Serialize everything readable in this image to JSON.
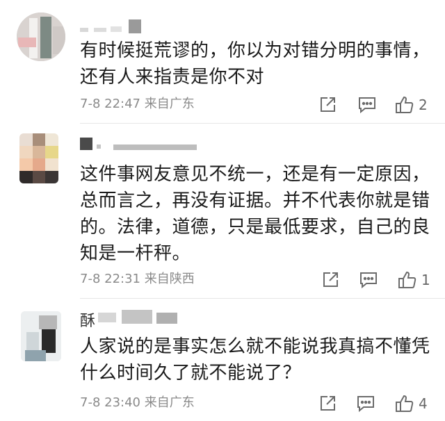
{
  "comments": [
    {
      "text": "有时候挺荒谬的，你以为对错分明的事情，还有人来指责是你不对",
      "time": "7-8 22:47",
      "location": "来自广东",
      "likes": "2"
    },
    {
      "text": "这件事网友意见不统一，还是有一定原因，总而言之，再没有证据。并不代表你就是错的。法律，道德，只是最低要求，自己的良知是一杆秤。",
      "time": "7-8 22:31",
      "location": "来自陕西",
      "likes": "1"
    },
    {
      "username_visible": "酥",
      "text": "人家说的是事实怎么就不能说我真搞不懂凭什么时间久了就不能说了？",
      "time": "7-8 23:40",
      "location": "来自广东",
      "likes": "4"
    }
  ],
  "icons": {
    "share": "share-icon",
    "comment": "comment-icon",
    "like": "thumbs-up-icon"
  },
  "colors": {
    "text": "#1a1a1a",
    "meta": "#8a8a8a",
    "icon": "#6b6b6b"
  }
}
